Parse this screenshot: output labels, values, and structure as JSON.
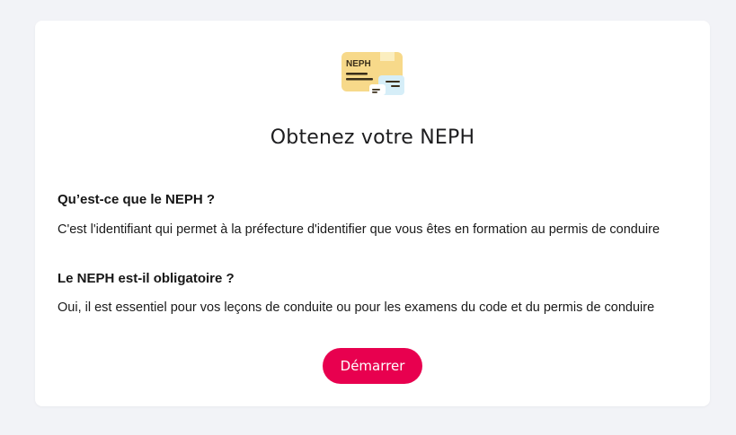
{
  "card": {
    "icon": "neph-document-icon",
    "icon_label": "NEPH",
    "title": "Obtenez votre NEPH",
    "faq": [
      {
        "question": "Qu’est-ce que le NEPH ?",
        "answer": "C'est l'identifiant qui permet à la préfecture d'identifier que vous êtes en formation au permis de conduire"
      },
      {
        "question": "Le NEPH est-il obligatoire ?",
        "answer": "Oui, il est essentiel pour vos leçons de conduite ou pour les examens du code et du permis de conduire"
      }
    ],
    "button_label": "Démarrer"
  },
  "colors": {
    "background": "#f2f3f7",
    "card": "#ffffff",
    "accent": "#e8004f",
    "icon_yellow": "#f7d98a",
    "icon_blue": "#d6eef8"
  }
}
